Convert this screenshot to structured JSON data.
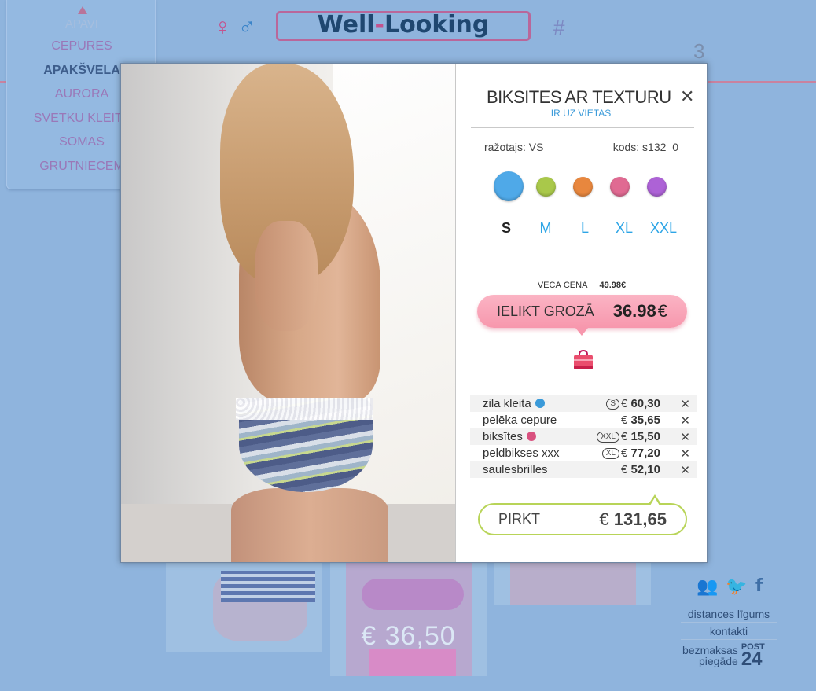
{
  "header": {
    "gender_female": "♀",
    "gender_male": "♂",
    "logo_part1": "Well",
    "logo_dash": "-",
    "logo_part2": "Looking",
    "hash": "#",
    "cart_count": "3"
  },
  "sidebar": {
    "faded_item": "APAVI",
    "items": [
      {
        "label": "CEPURES",
        "active": false
      },
      {
        "label": "APAKŠVELA",
        "active": true
      },
      {
        "label": "AURORA",
        "active": false
      },
      {
        "label": "SVETKU KLEITA",
        "active": false
      },
      {
        "label": "SOMAS",
        "active": false
      },
      {
        "label": "GRUTNIECEM",
        "active": false
      }
    ]
  },
  "background": {
    "thumb_price": "€ 36,50"
  },
  "footer": {
    "links": [
      "distances līgums",
      "kontakti"
    ],
    "shipping_line1": "bezmaksas",
    "shipping_line2": "piegāde",
    "post_word": "POST",
    "post_num": "24"
  },
  "product": {
    "title": "BIKSITES AR TEXTURU",
    "stock": "IR UZ VIETAS",
    "maker": "ražotajs: VS",
    "code": "kods: s132_0",
    "colors": [
      "#4fa9e8",
      "#a9c84a",
      "#e8873e",
      "#e06a92",
      "#ad62d6"
    ],
    "sizes": [
      "S",
      "M",
      "L",
      "XL",
      "XXL"
    ],
    "selected_size": "S",
    "old_price_label": "VECĀ CENA",
    "old_price": "49.98€",
    "add_label": "IELIKT GROZĀ",
    "price": "36.98",
    "currency": "€"
  },
  "cart": {
    "items": [
      {
        "name": "zila kleita",
        "dot": "#3a9ad9",
        "size": "S",
        "currency": "€",
        "price": "60,30"
      },
      {
        "name": "pelēka cepure",
        "dot": "",
        "size": "",
        "currency": "€",
        "price": "35,65"
      },
      {
        "name": "biksītes",
        "dot": "#d9517f",
        "size": "XXL",
        "currency": "€",
        "price": "15,50"
      },
      {
        "name": "peldbikses xxx",
        "dot": "",
        "size": "XL",
        "currency": "€",
        "price": "77,20"
      },
      {
        "name": "saulesbrilles",
        "dot": "",
        "size": "",
        "currency": "€",
        "price": "52,10"
      }
    ],
    "buy_label": "PIRKT",
    "total_currency": "€",
    "total": "131,65"
  }
}
